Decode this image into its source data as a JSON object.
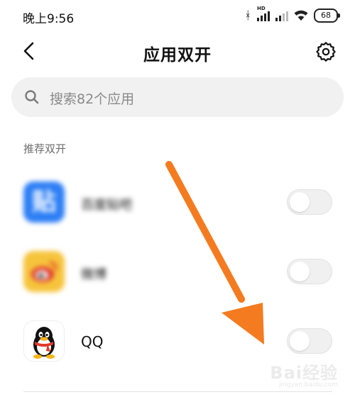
{
  "status_bar": {
    "time": "晚上9:56",
    "hd_label": "HD",
    "battery": "68"
  },
  "header": {
    "title": "应用双开"
  },
  "search": {
    "placeholder": "搜索82个应用"
  },
  "section": {
    "title": "推荐双开"
  },
  "apps": [
    {
      "name": "百度贴吧",
      "icon": "tieba-icon",
      "enabled": false
    },
    {
      "name": "微博",
      "icon": "weibo-icon",
      "enabled": false
    },
    {
      "name": "QQ",
      "icon": "qq-penguin-icon",
      "enabled": false
    }
  ],
  "icons": {
    "back": "chevron-left-icon",
    "settings": "gear-icon",
    "search": "search-icon",
    "tieba_glyph": "贴"
  },
  "annotation": {
    "arrow_color": "#f47b20"
  },
  "watermark": {
    "main": "Bai经验",
    "sub": "jingyan.baidu.com"
  },
  "colors": {
    "tieba_blue": "#2d7ff5",
    "weibo_yellow": "#f6c43c",
    "weibo_red": "#e0322b",
    "qq_scarf": "#e23a2b"
  }
}
